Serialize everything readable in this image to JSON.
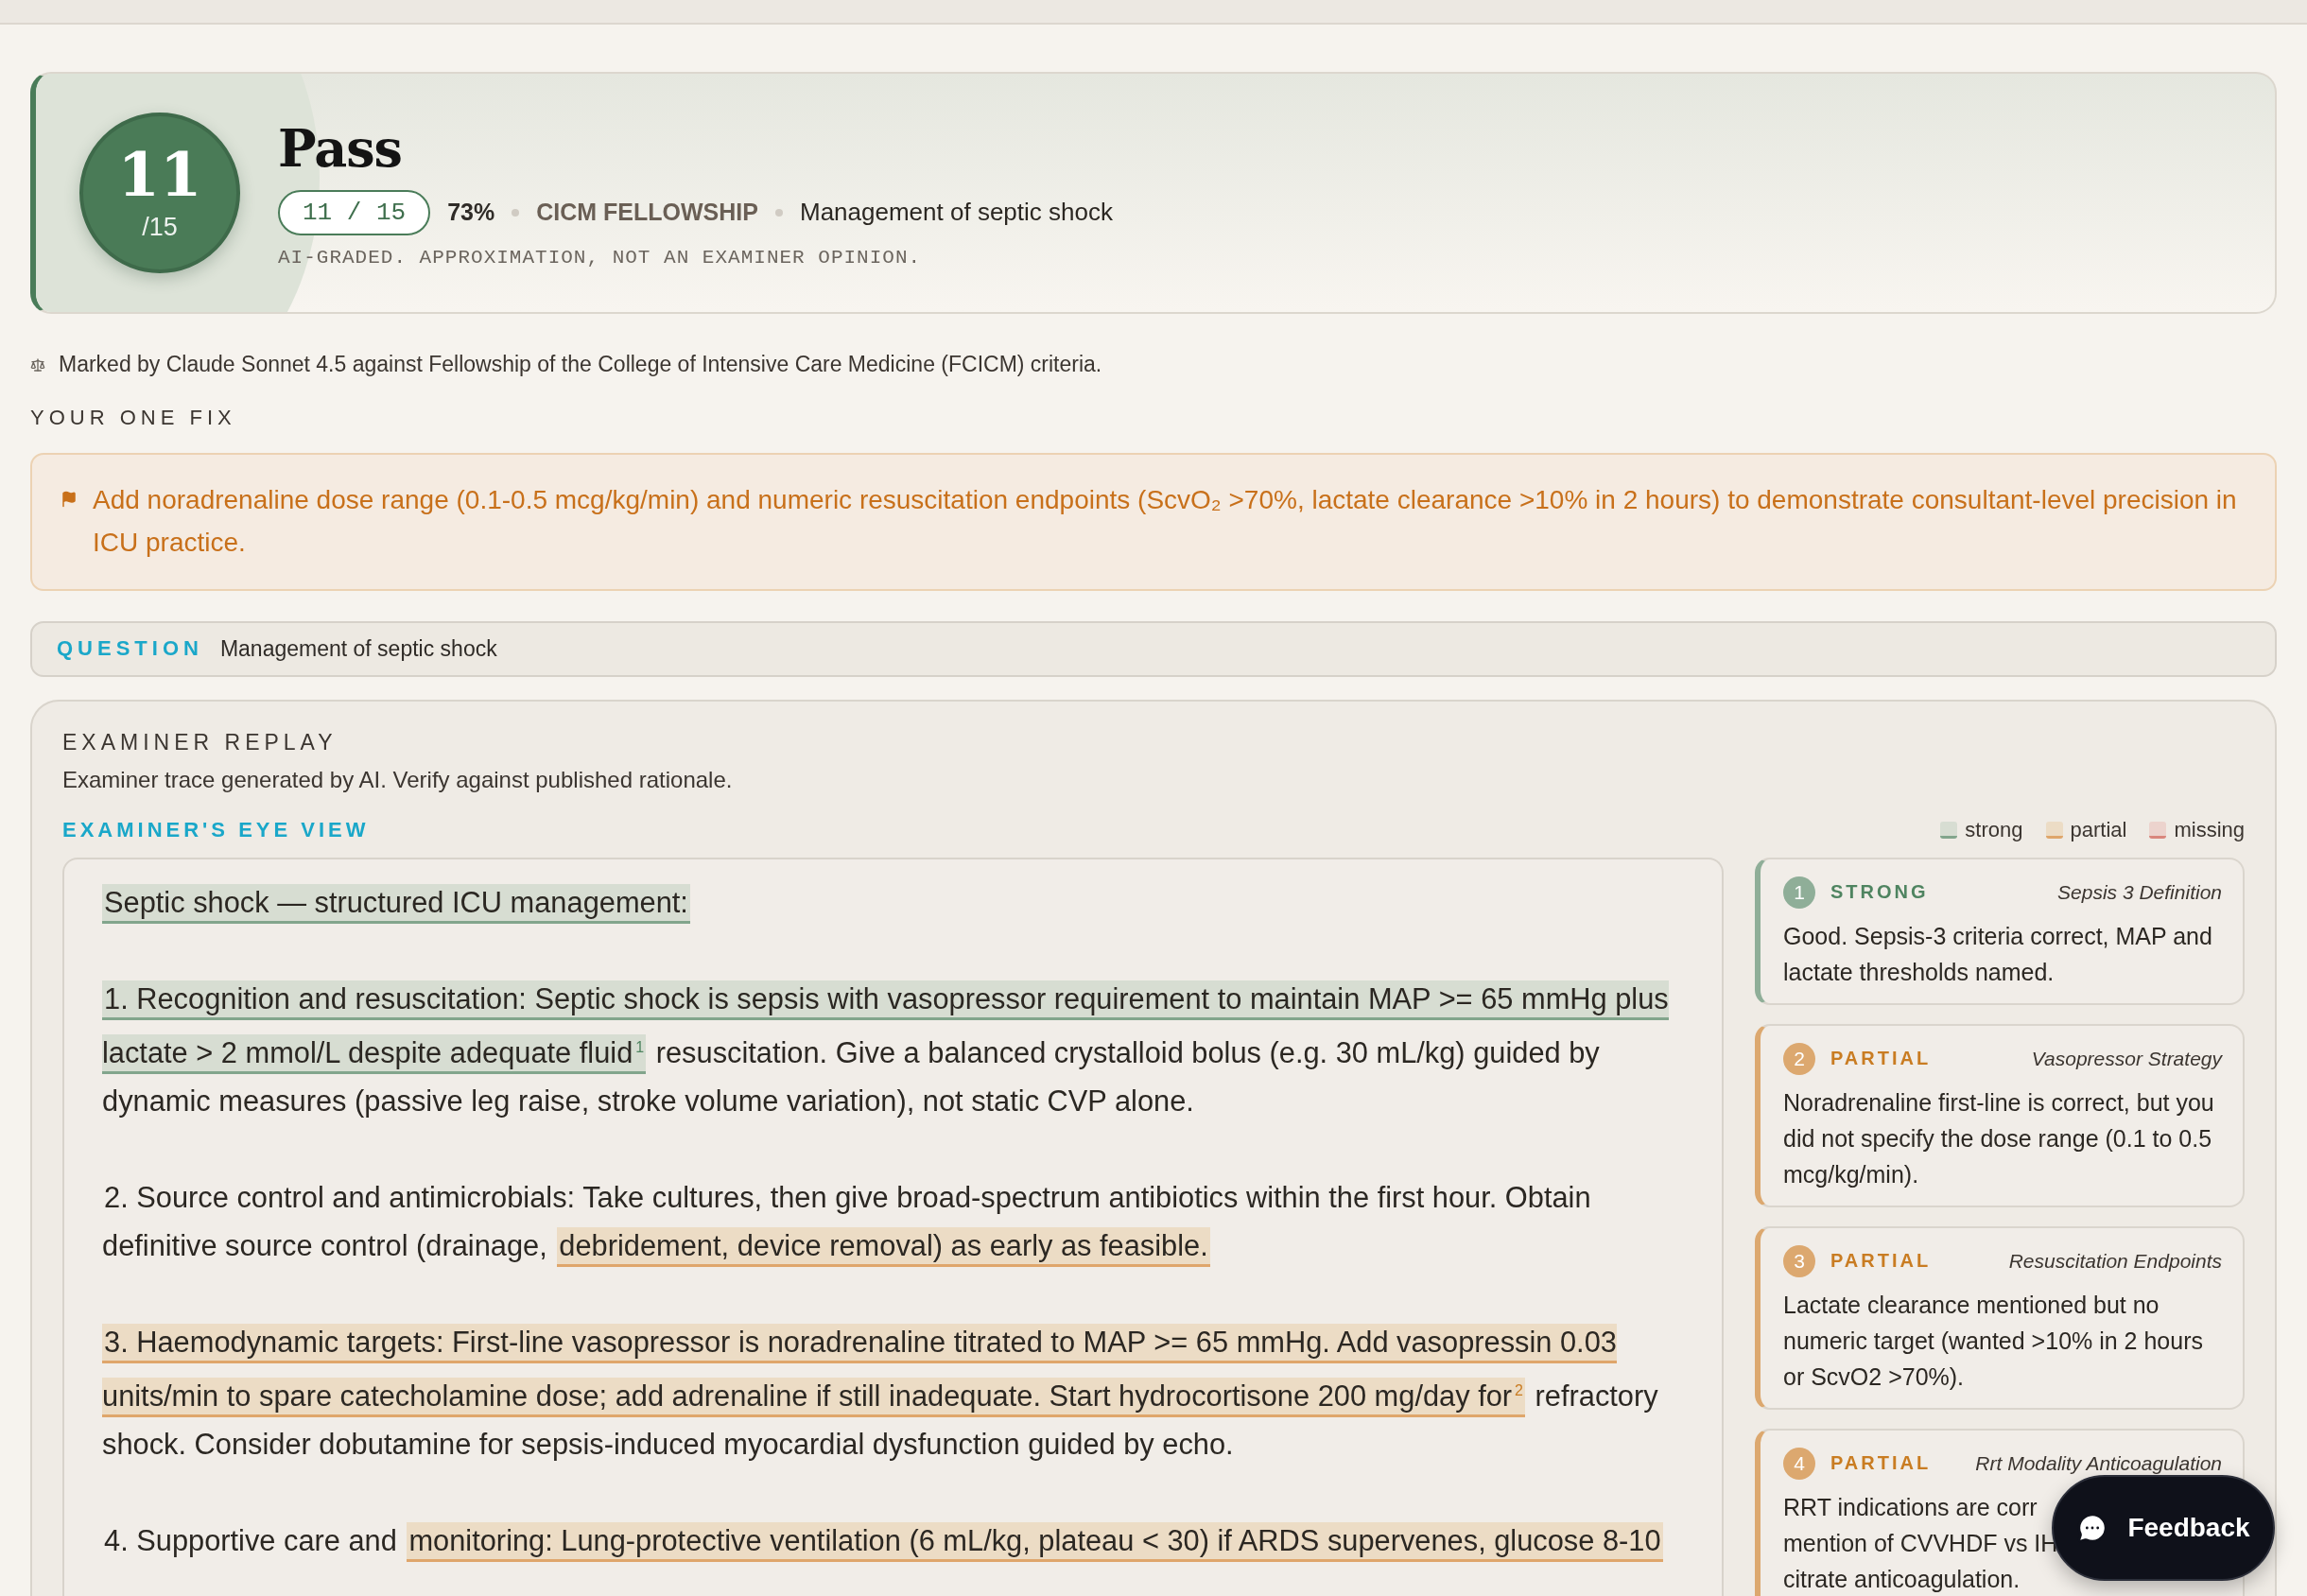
{
  "hero": {
    "score": "11",
    "out_of": "/15",
    "verdict": "Pass",
    "pill": "11 / 15",
    "percent": "73%",
    "exam": "CICM FELLOWSHIP",
    "topic": "Management of septic shock",
    "disclaimer": "AI-GRADED. APPROXIMATION, NOT AN EXAMINER OPINION."
  },
  "marked_by": "Marked by Claude Sonnet 4.5 against Fellowship of the College of Intensive Care Medicine (FCICM) criteria.",
  "one_fix": {
    "heading": "YOUR ONE FIX",
    "text": "Add noradrenaline dose range (0.1-0.5 mcg/kg/min) and numeric resuscitation endpoints (ScvO₂ >70%, lactate clearance >10% in 2 hours) to demonstrate consultant-level precision in ICU practice."
  },
  "question": {
    "label": "QUESTION",
    "text": "Management of septic shock"
  },
  "replay": {
    "title": "EXAMINER REPLAY",
    "subtitle": "Examiner trace generated by AI. Verify against published rationale.",
    "view_label": "EXAMINER'S EYE VIEW",
    "legend": [
      {
        "label": "strong",
        "kind": "strong"
      },
      {
        "label": "partial",
        "kind": "partial"
      },
      {
        "label": "missing",
        "kind": "missing"
      }
    ],
    "paragraphs": [
      {
        "segments": [
          {
            "text": "Septic shock — structured ICU management:",
            "kind": "strong"
          }
        ]
      },
      {
        "segments": [
          {
            "text": "1. Recognition and resuscitation: Septic shock is sepsis with vasopressor requirement to maintain MAP >= 65 mmHg plus lactate > 2 mmol/L despite adequate fluid",
            "kind": "strong",
            "note": "1"
          },
          {
            "text": " resuscitation. Give a balanced crystalloid bolus (e.g. 30 mL/kg) guided by dynamic measures (passive leg raise, stroke volume variation), not static CVP alone.",
            "kind": "plain"
          }
        ]
      },
      {
        "segments": [
          {
            "text": "2. Source control and antimicrobials: Take cultures, then give broad-spectrum antibiotics within the first hour. Obtain definitive source control (drainage, ",
            "kind": "plain"
          },
          {
            "text": "debridement, device removal) as early as feasible.",
            "kind": "partial"
          }
        ]
      },
      {
        "segments": [
          {
            "text": "3. Haemodynamic targets: First-line vasopressor is noradrenaline titrated to MAP >= 65 mmHg. Add vasopressin 0.03 units/min to spare catecholamine dose; add adrenaline if still inadequate. Start hydrocortisone 200 mg/day for",
            "kind": "partial",
            "note": "2"
          },
          {
            "text": " refractory shock. Consider dobutamine for sepsis-induced myocardial dysfunction guided by echo.",
            "kind": "plain"
          }
        ]
      },
      {
        "segments": [
          {
            "text": "4. Supportive care and ",
            "kind": "plain"
          },
          {
            "text": "monitoring: Lung-protective ventilation (6 mL/kg, plateau < 30) if ARDS supervenes, glucose 8-10",
            "kind": "partial"
          }
        ]
      }
    ],
    "cards": [
      {
        "number": "1",
        "kind": "strong",
        "label": "STRONG",
        "topic": "Sepsis 3 Definition",
        "lines": [
          "Good. Sepsis-3 criteria correct, MAP and lactate thresholds named."
        ]
      },
      {
        "number": "2",
        "kind": "partial",
        "label": "PARTIAL",
        "topic": "Vasopressor Strategy",
        "lines": [
          "Noradrenaline first-line is correct, but you did not specify the dose range (0.1 to 0.5 mcg/kg/min)."
        ]
      },
      {
        "number": "3",
        "kind": "partial",
        "label": "PARTIAL",
        "topic": "Resuscitation Endpoints",
        "lines": [
          "Lactate clearance mentioned but no numeric target (wanted >10% in 2 hours or ScvO2 >70%)."
        ]
      },
      {
        "number": "4",
        "kind": "partial",
        "label": "PARTIAL",
        "topic": "Rrt Modality Anticoagulation",
        "lines": [
          "RRT indications are corr",
          "mention of CVVHDF vs IH",
          "citrate anticoagulation."
        ]
      }
    ]
  },
  "feedback_button": "Feedback"
}
